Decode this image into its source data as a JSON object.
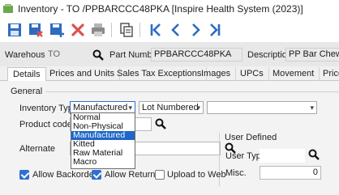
{
  "window": {
    "title": "Inventory - TO   /PPBARCCC48PKA [Inspire Health System (2023)]"
  },
  "toolbar": {
    "buttons": [
      {
        "name": "save-icon",
        "color": "#2e6bbf"
      },
      {
        "name": "save-close-icon",
        "color": "#2e6bbf"
      },
      {
        "name": "save-new-icon",
        "color": "#2e6bbf"
      },
      {
        "name": "delete-icon",
        "color": "#d9534f"
      },
      {
        "name": "print-icon",
        "color": "#8a8a8a"
      },
      {
        "name": "copy-icon",
        "color": "#555555"
      },
      {
        "name": "first-record-icon",
        "color": "#2e6bbf"
      },
      {
        "name": "previous-record-icon",
        "color": "#2e6bbf"
      },
      {
        "name": "next-record-icon",
        "color": "#2e6bbf"
      },
      {
        "name": "last-record-icon",
        "color": "#2e6bbf"
      }
    ]
  },
  "header": {
    "warehouse_label": "Warehouse",
    "warehouse_value": "TO",
    "part_number_label": "Part Number",
    "part_number_value": "PPBARCCC48PKA",
    "description_label": "Description",
    "description_value": "PP Bar Chewy Cl"
  },
  "tabs": [
    "Details",
    "Prices and Units",
    "Sales Tax Exceptions",
    "Images",
    "UPCs",
    "Movement",
    "Price"
  ],
  "details": {
    "general_label": "General",
    "inventory_type_label": "Inventory Type",
    "inventory_type_value": "Manufactured",
    "lot_value": "Lot Numbered",
    "third_combo_value": "",
    "product_code_label": "Product code",
    "alternate_label": "Alternate",
    "user_defined_label": "User Defined",
    "user_type_label": "User Type",
    "misc_label": "Misc.",
    "misc_value": "0",
    "allow_backorders_label": "Allow Backorders",
    "allow_returns_label": "Allow Returns",
    "upload_to_web_label": "Upload to Web",
    "allow_backorders": true,
    "allow_returns": true,
    "upload_to_web": false
  },
  "inventory_type_options": [
    "Normal",
    "Non-Physical",
    "Manufactured",
    "Kitted",
    "Raw Material",
    "Macro"
  ],
  "inventory_type_selected_index": 2,
  "colors": {
    "accent": "#1e66c8",
    "toolbar_blue": "#2e6bbf",
    "delete_red": "#d9534f"
  }
}
